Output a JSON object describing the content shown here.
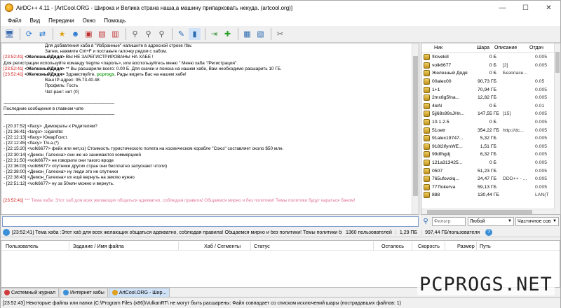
{
  "window": {
    "title": "AirDC++ 4.11 - [ArtCool.ORG - Широка и Велика страна наша,а машину припарковать некуда. (artcool.org)]",
    "buttons": {
      "minimize": "—",
      "maximize": "☐",
      "close": "✕"
    }
  },
  "menu": [
    "Файл",
    "Вид",
    "Передачи",
    "Окно",
    "Помощь"
  ],
  "toolbar_icons": [
    "connect-icon",
    "reconnect-icon",
    "follow-redirect-icon",
    "favorites-icon",
    "favorite-users-icon",
    "recent-hubs-icon",
    "user-commands-icon",
    "public-hubs-icon",
    "search-icon",
    "adl-search-icon",
    "search-spy-icon",
    "notepad-icon",
    "queue-icon",
    "finished-icon",
    "upload-queue-icon",
    "open-folder-icon",
    "network-stats-icon",
    "settings-icon"
  ],
  "chat": [
    {
      "ts": "",
      "nick": "",
      "text": "Для добавления хаба в \"Избранные\" напишите в адресной строке /fav.",
      "indent": true
    },
    {
      "ts": "",
      "nick": "",
      "text": "Затем, нажмите  Ctrl+F  и поставьте галочку рядом с хабом.",
      "indent": true
    },
    {
      "ts": "[23:52:41]",
      "nick": "<ЖелезныйДядя>",
      "text": "ВЫ НЕ ЗАРЕГИСТРИРОВАНЫ НА ХАБЕ !",
      "tsred": true
    },
    {
      "ts": "",
      "nick": "",
      "text": "Для регистрации используйте команду !regme <пароль>, или воспользуйтесь меню \" Меню хаба \"/Регистрация\"."
    },
    {
      "ts": "[23:52:41]",
      "nick": "<ЖелезныйДядя>",
      "text": "** Вы расшарили всего: 0.00 Б. Для скачки и поиска на нашем хабе, Вам необходимо расшарить 10 ГБ.",
      "tsred": true
    },
    {
      "ts": "[23:52:41]",
      "nick": "<ЖелезныйДядя>",
      "text": "Здравствуйте, pcprogs. Рады видеть Вас на нашем хабе!",
      "tsred": true,
      "green": "pcprogs"
    },
    {
      "ts": "",
      "nick": "",
      "text": "Ваш IP-адрес:                95.73.40.48",
      "indent": true
    },
    {
      "ts": "",
      "nick": "",
      "text": "Профиль:                      Гость",
      "indent": true
    },
    {
      "ts": "",
      "nick": "",
      "text": "Чат-ранг:                      нет (0)",
      "indent": true
    },
    {
      "ts": "",
      "nick": "",
      "text": ""
    },
    {
      "ts": "",
      "nick": "",
      "text": "-------------------------------------------------------------------------------------------------",
      "sep": true
    },
    {
      "ts": "",
      "nick": "",
      "text": "    Последние сообщения в главном чате"
    },
    {
      "ts": "",
      "nick": "",
      "text": "-------------------------------------------------------------------------------------------------",
      "sep": true
    },
    {
      "ts": "",
      "nick": "",
      "text": ""
    },
    {
      "ts": "- [20:37:52]",
      "nick": "<flacy>",
      "text": ".Демократы к Родителям?"
    },
    {
      "ts": "- [21:36:41]",
      "nick": "<largo>",
      "text": ":cigarette:"
    },
    {
      "ts": "- [22:12:13]",
      "nick": "<flacy>",
      "text": "ЮмарГсист."
    },
    {
      "ts": "- [22:12:45]",
      "nick": "<flacy>",
      "text": "Т/к.а.(*)"
    },
    {
      "ts": "- [22:15:20]",
      "nick": "<volk6677>",
      "text": "фейк или нет,хз) Стоимость туристического полета на космическом корабле \"Союз\" составляет около $50 млн."
    },
    {
      "ts": "- [22:30:14]",
      "nick": "<Демон_Галеона>",
      "text": "они же не занимаются коммерцией"
    },
    {
      "ts": "- [22:31:50]",
      "nick": "<volk6677>",
      "text": "не говорили они такого вроде"
    },
    {
      "ts": "- [22:36:03]",
      "nick": "<volk6677>",
      "text": "спутники других стран они бесплатно запускают чтоли)"
    },
    {
      "ts": "- [22:38:00]",
      "nick": "<Демон_Галеона>",
      "text": "ну люди это не спутники"
    },
    {
      "ts": "- [22:38:43]",
      "nick": "<Демон_Галеона>",
      "text": "их ещё вернуть на землю нужно"
    },
    {
      "ts": "- [22:51:12]",
      "nick": "<volk6677>",
      "text": "ну за 50млн можно и вернуть."
    },
    {
      "ts": "",
      "nick": "",
      "text": ""
    },
    {
      "ts": "",
      "nick": "",
      "text": ""
    },
    {
      "ts": "[23:52:41]",
      "nick": "",
      "text": "*** Тема хаба: Этот хаб для всех желающих общаться адекватно, соблюдая правила! Общаемся мирно и без политики! Темы политики будут караться баном!",
      "tsred": true,
      "rules": true
    }
  ],
  "userlist": {
    "columns": [
      "Ник",
      "Шара",
      "Описание",
      "Отдач"
    ],
    "users": [
      {
        "nick": "!llovekill",
        "share": "0 Б",
        "desc": "",
        "rcv": "0.005"
      },
      {
        "nick": "volk6677",
        "share": "0 Б",
        "desc": "[2]",
        "rcv": "0.005"
      },
      {
        "nick": "Железный Дядя",
        "share": "0 Б",
        "desc": "Безопасн...",
        "rcv": ""
      },
      {
        "nick": "00alex00",
        "share": "90,73 ГБ",
        "desc": "",
        "rcv": "0.05"
      },
      {
        "nick": "1+1",
        "share": "70,94 ГБ",
        "desc": "",
        "rcv": "0.005"
      },
      {
        "nick": "2mx8g5fna...",
        "share": "12,82 ГБ",
        "desc": "",
        "rcv": "0.005"
      },
      {
        "nick": "4leN",
        "share": "0 Б",
        "desc": "",
        "rcv": "0.01"
      },
      {
        "nick": "5jj68s99sJHn...",
        "share": "147,55 ГБ",
        "desc": "[15]",
        "rcv": "0.005"
      },
      {
        "nick": "10.1.2.5",
        "share": "0 Б",
        "desc": "",
        "rcv": "0.005"
      },
      {
        "nick": "51oetr",
        "share": "354,22 ГБ",
        "desc": "http://dc...",
        "rcv": "0.005"
      },
      {
        "nick": "91alex19747...",
        "share": "5,32 ГБ",
        "desc": "",
        "rcv": "0.005"
      },
      {
        "nick": "918l2ifynWE...",
        "share": "1,51 ГБ",
        "desc": "",
        "rcv": "0.005"
      },
      {
        "nick": "99dfhgdj",
        "share": "6,32 ГБ",
        "desc": "",
        "rcv": "0.005"
      },
      {
        "nick": "121a313425...",
        "share": "0 Б",
        "desc": "",
        "rcv": "0.005"
      },
      {
        "nick": "0507",
        "share": "51,23 ГБ",
        "desc": "",
        "rcv": "0.005"
      },
      {
        "nick": "765ufovolq...",
        "share": "24,47 ГБ",
        "desc": "DDD++ - ...",
        "rcv": "0.005"
      },
      {
        "nick": "777lokerva",
        "share": "59,13 ГБ",
        "desc": "",
        "rcv": "0.005"
      },
      {
        "nick": "888",
        "share": "130,44 ГБ",
        "desc": "",
        "rcv": "LAN(T"
      }
    ]
  },
  "input": {
    "message_value": "",
    "filter_placeholder": "Фильтр",
    "filter_column": "Любой",
    "filter_mode": "Частичное сов"
  },
  "statusbar_top": {
    "message": "[23:52:41] Тема хаба :Этот хаб для всех желающих общаться адекватно, соблюдая правила! Общаемся мирно и без политики! Темы политики будут караться бан",
    "users": "1360 пользователей",
    "share": "1,29 ПБ",
    "per_user": "997,44 ГБ/пользователя"
  },
  "queue": {
    "columns": [
      "Пользователь",
      "Задание / Имя файла",
      "Хаб / Сегменты",
      "Статус",
      "Осталось",
      "Скорость",
      "Размер",
      "Путь"
    ]
  },
  "tabs": [
    {
      "label": "Системный журнал",
      "color": "#d23b3b",
      "active": false
    },
    {
      "label": "Интернет хабы",
      "color": "#3a8fd8",
      "active": false
    },
    {
      "label": "ArtCool.ORG - Шир...",
      "color": "#e0a020",
      "active": true
    }
  ],
  "statusbar_bottom": {
    "message": "[23:52:43] Некоторые файлы или папки (C:\\Program Files (x86)\\VulkanRT\\ не могут быть расшарены: Файл совпадает со списком исключений шары (пострадавших файлов: 1)"
  },
  "watermark": "PCPROGS.NET"
}
